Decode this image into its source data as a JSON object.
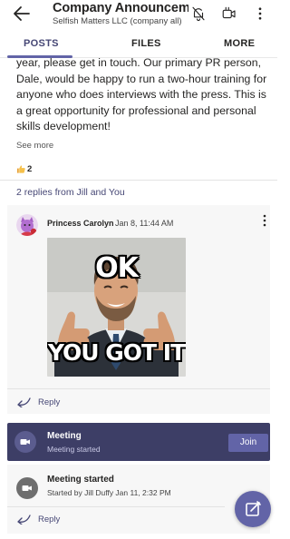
{
  "header": {
    "title": "Company Announceme...",
    "subtitle": "Selfish Matters LLC (company all)",
    "icons": [
      "back-arrow-icon",
      "bell-off-icon",
      "video-meet-icon",
      "more-vertical-icon"
    ]
  },
  "tabs": [
    {
      "label": "POSTS",
      "active": true
    },
    {
      "label": "FILES",
      "active": false
    },
    {
      "label": "MORE",
      "active": false
    }
  ],
  "post": {
    "body": "year, please get in touch. Our primary PR person, Dale, would be happy to run a two-hour training for anyone who does interviews with the press. This is a great opportunity for professional and personal skills development!",
    "see_more": "See more",
    "reaction_count": "2"
  },
  "replies": {
    "summary": "2 replies from Jill and You",
    "items": [
      {
        "author": "Princess Carolyn",
        "time": "Jan 8, 11:44 AM",
        "image": {
          "kind": "meme-ok-you-got-it",
          "top_text": "OK",
          "bottom_text": "YOU GOT IT"
        }
      }
    ],
    "reply_label": "Reply"
  },
  "meeting": {
    "title": "Meeting",
    "status": "Meeting started",
    "join_label": "Join"
  },
  "meeting_started": {
    "title": "Meeting started",
    "detail": "Started by Jill Duffy  Jan 11, 2:32 PM",
    "reply_label": "Reply"
  },
  "colors": {
    "accent": "#6264a7",
    "meeting_bar": "#3d3e66"
  }
}
